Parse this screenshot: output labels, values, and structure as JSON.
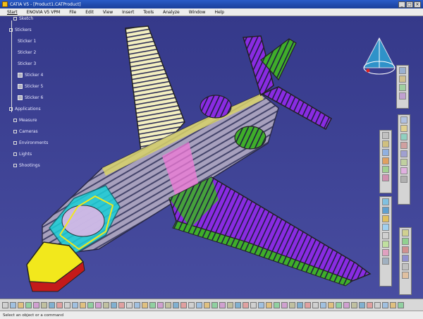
{
  "window": {
    "title": "CATIA V5 - [Product1.CATProduct]"
  },
  "menu": [
    "Start",
    "ENOVIA V5 VPM",
    "File",
    "Edit",
    "View",
    "Insert",
    "Tools",
    "Analyze",
    "Window",
    "Help"
  ],
  "tree": {
    "items": [
      {
        "label": "Sketch",
        "kind": "leaf"
      },
      {
        "label": "Stickers",
        "kind": "branch"
      },
      {
        "label": "Sticker 1",
        "kind": "leaf"
      },
      {
        "label": "Sticker 2",
        "kind": "leaf"
      },
      {
        "label": "Sticker 3",
        "kind": "leaf"
      },
      {
        "label": "Sticker 4",
        "kind": "part"
      },
      {
        "label": "Sticker 5",
        "kind": "part"
      },
      {
        "label": "Sticker 6",
        "kind": "part"
      },
      {
        "label": "Applications",
        "kind": "branch"
      },
      {
        "label": "Measure",
        "kind": "branch"
      },
      {
        "label": "Cameras",
        "kind": "branch"
      },
      {
        "label": "Environments",
        "kind": "branch"
      },
      {
        "label": "Lights",
        "kind": "branch"
      },
      {
        "label": "Shootings",
        "kind": "branch"
      }
    ]
  },
  "status": {
    "text": "Select an object or a command"
  },
  "icons": {
    "compass": "compass-icon",
    "app": "catia-logo-icon"
  },
  "colors": {
    "background": "#3a3f88",
    "wing_purple": "#8a2be2",
    "wing_green": "#3fae2a",
    "wing_cream": "#f3efc0",
    "cockpit_cyan": "#1bd0d8",
    "nose_yellow": "#f2e81c",
    "nose_red": "#c41a1a",
    "frame_pink": "#f07ad8"
  }
}
